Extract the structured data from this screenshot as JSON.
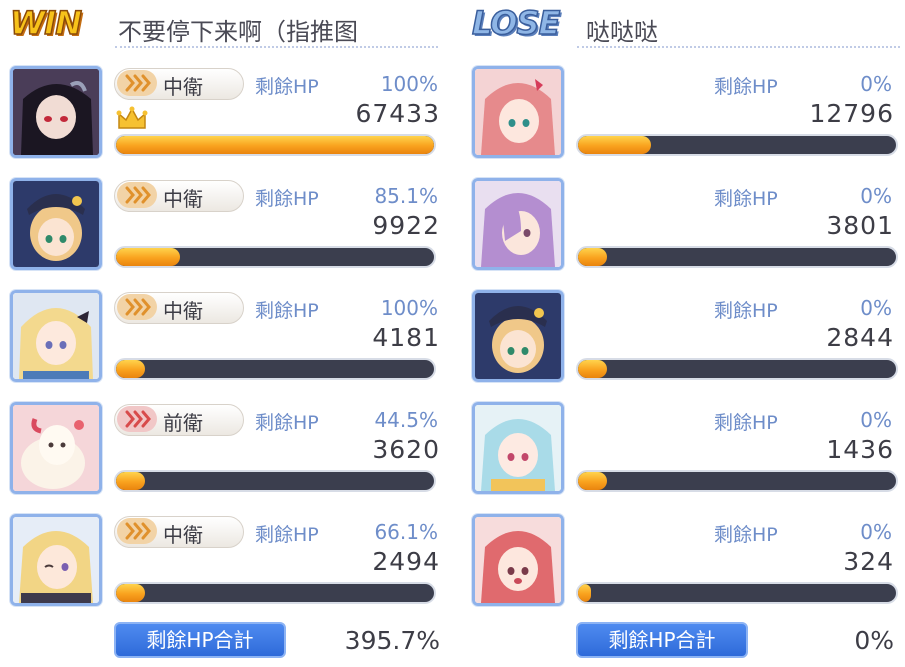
{
  "win_team": {
    "badge": "WIN",
    "player_name": "不要停下来啊（指推图",
    "rows": [
      {
        "role": "中衛",
        "hp_label": "剩餘HP",
        "hp_pct": "100%",
        "damage": "67433",
        "bar_fill": 1.0,
        "crown": true,
        "portrait": "dark-haired-character"
      },
      {
        "role": "中衛",
        "hp_label": "剩餘HP",
        "hp_pct": "85.1%",
        "damage": "9922",
        "bar_fill": 0.2,
        "crown": false,
        "portrait": "blonde-hat-character"
      },
      {
        "role": "中衛",
        "hp_label": "剩餘HP",
        "hp_pct": "100%",
        "damage": "4181",
        "bar_fill": 0.09,
        "crown": false,
        "portrait": "blonde-ribbon-character"
      },
      {
        "role": "前衛",
        "hp_label": "剩餘HP",
        "hp_pct": "44.5%",
        "damage": "3620",
        "bar_fill": 0.09,
        "crown": false,
        "portrait": "alpaca-character"
      },
      {
        "role": "中衛",
        "hp_label": "剩餘HP",
        "hp_pct": "66.1%",
        "damage": "2494",
        "bar_fill": 0.09,
        "crown": false,
        "portrait": "blonde-wink-character"
      }
    ],
    "total_label": "剩餘HP合計",
    "total_value": "395.7%"
  },
  "lose_team": {
    "badge": "LOSE",
    "player_name": "哒哒哒",
    "rows": [
      {
        "hp_label": "剩餘HP",
        "hp_pct": "0%",
        "damage": "12796",
        "bar_fill": 0.23,
        "portrait": "pink-haired-character"
      },
      {
        "hp_label": "剩餘HP",
        "hp_pct": "0%",
        "damage": "3801",
        "bar_fill": 0.09,
        "portrait": "purple-haired-character"
      },
      {
        "hp_label": "剩餘HP",
        "hp_pct": "0%",
        "damage": "2844",
        "bar_fill": 0.09,
        "portrait": "blonde-hat-character"
      },
      {
        "hp_label": "剩餘HP",
        "hp_pct": "0%",
        "damage": "1436",
        "bar_fill": 0.09,
        "portrait": "lightblue-haired-character"
      },
      {
        "hp_label": "剩餘HP",
        "hp_pct": "0%",
        "damage": "324",
        "bar_fill": 0.04,
        "portrait": "red-haired-character"
      }
    ],
    "total_label": "剩餘HP合計",
    "total_value": "0%"
  },
  "colors": {
    "bar_fill": "#f9a21e",
    "bar_bg": "#3b3e4e",
    "accent_blue": "#6e8dc9",
    "button_blue": "#2e6ad9",
    "win_gold": "#f7c21a",
    "lose_blue": "#8fb6e6"
  }
}
